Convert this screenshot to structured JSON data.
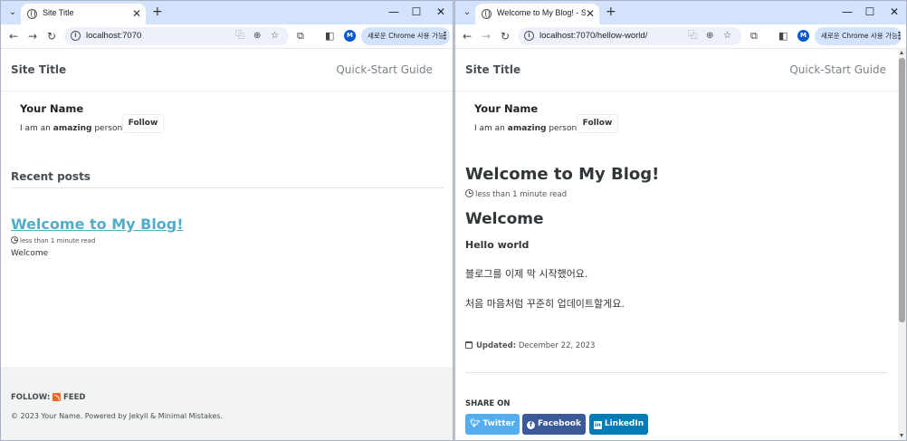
{
  "left": {
    "tab_title": "Site Title",
    "url": "localhost:7070",
    "chrome_pill": "새로운 Chrome 사용 가능",
    "site_title": "Site Title",
    "nav_link": "Quick-Start Guide",
    "author": {
      "name": "Your Name",
      "bio_prefix": "I am an ",
      "bio_bold": "amazing",
      "bio_suffix": " person.",
      "follow_label": "Follow"
    },
    "recent_heading": "Recent posts",
    "post": {
      "title": "Welcome to My Blog!",
      "read_time": "less than 1 minute read",
      "excerpt": "Welcome"
    },
    "footer": {
      "follow_label": "FOLLOW:",
      "feed_label": "FEED",
      "copyright": "© 2023 Your Name. Powered by Jekyll & Minimal Mistakes."
    }
  },
  "right": {
    "tab_title": "Welcome to My Blog! - Site Title",
    "url": "localhost:7070/hellow-world/",
    "chrome_pill": "새로운 Chrome 사용 가능",
    "site_title": "Site Title",
    "nav_link": "Quick-Start Guide",
    "author": {
      "name": "Your Name",
      "bio_prefix": "I am an ",
      "bio_bold": "amazing",
      "bio_suffix": " person.",
      "follow_label": "Follow"
    },
    "article": {
      "title": "Welcome to My Blog!",
      "read_time": "less than 1 minute read",
      "h1": "Welcome",
      "h3": "Hello world",
      "p1": "블로그를 이제 막 시작했어요.",
      "p2": "처음 마음처럼 꾸준히 업데이트할게요.",
      "updated_label": "Updated:",
      "updated_date": "December 22, 2023",
      "share_heading": "SHARE ON",
      "share_twitter": "Twitter",
      "share_facebook": "Facebook",
      "share_linkedin": "LinkedIn"
    }
  },
  "browser": {
    "avatar_letter": "M"
  },
  "colors": {
    "link": "#52adc8",
    "twitter": "#55acee",
    "facebook": "#3b5998",
    "linkedin": "#007bb6",
    "tabstrip": "#d3e3fd"
  }
}
